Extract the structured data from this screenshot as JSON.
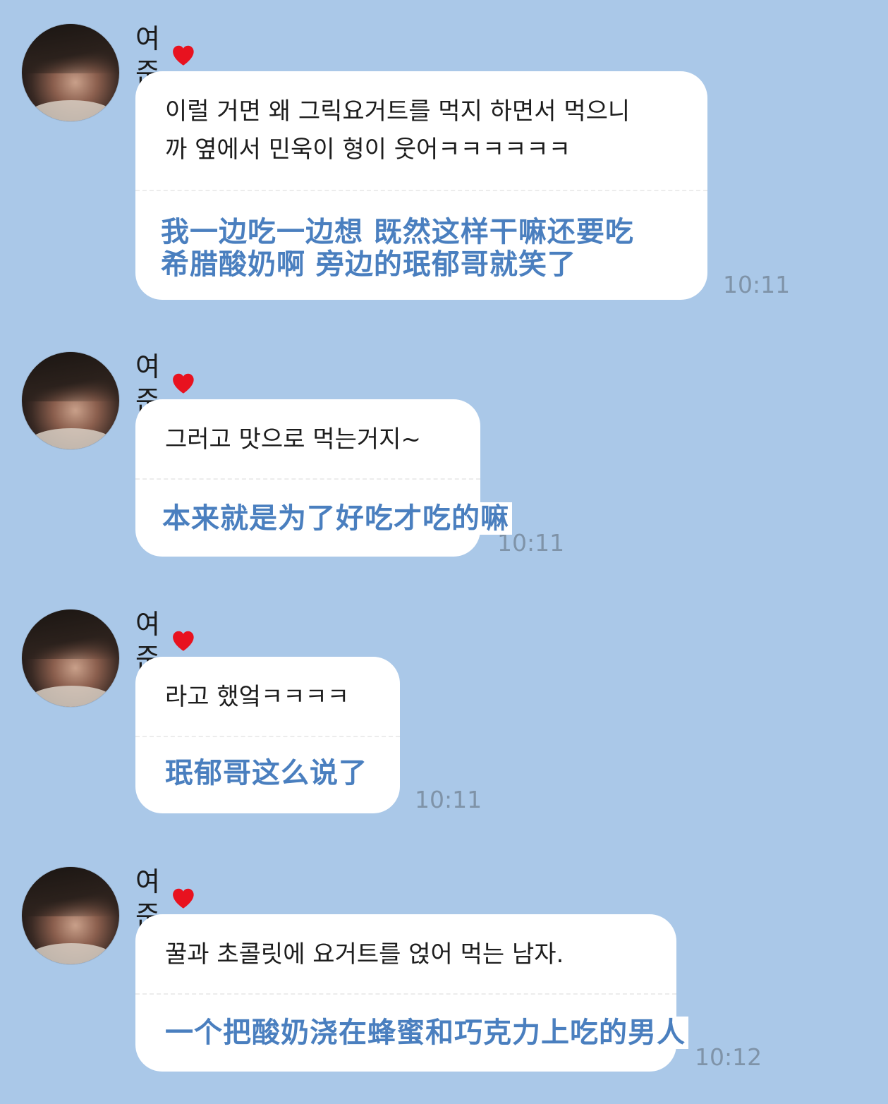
{
  "contact": {
    "name": "여준",
    "heart_color": "#e8121f"
  },
  "messages": [
    {
      "korean": "이럴 거면 왜 그릭요거트를 먹지 하면서 먹으니까 옆에서 민욱이 형이 웃어ㅋㅋㅋㅋㅋㅋ",
      "korean_line1": "이럴 거면 왜 그릭요거트를 먹지 하면서 먹으니",
      "korean_line2": "까 옆에서 민욱이 형이 웃어ㅋㅋㅋㅋㅋㅋ",
      "chinese_line1": "我一边吃一边想 既然这样干嘛还要吃",
      "chinese_line2": "希腊酸奶啊  旁边的珉郁哥就笑了",
      "time": "10:11"
    },
    {
      "korean_line1": "그러고 맛으로 먹는거지~",
      "chinese_line1": "本来就是为了好吃才吃的嘛",
      "time": "10:11"
    },
    {
      "korean_line1": "라고 했엌ㅋㅋㅋㅋ",
      "chinese_line1": "珉郁哥这么说了",
      "time": "10:11"
    },
    {
      "korean_line1": "꿀과 초콜릿에 요거트를 얹어 먹는 남자.",
      "chinese_line1": "一个把酸奶浇在蜂蜜和巧克力上吃的男人",
      "time": "10:12"
    }
  ],
  "colors": {
    "background": "#aac8e8",
    "bubble": "#ffffff",
    "translation_text": "#4a7fbf",
    "timestamp": "#7f93a8"
  },
  "icons": {
    "heart": "heart-icon",
    "avatar": "avatar"
  }
}
